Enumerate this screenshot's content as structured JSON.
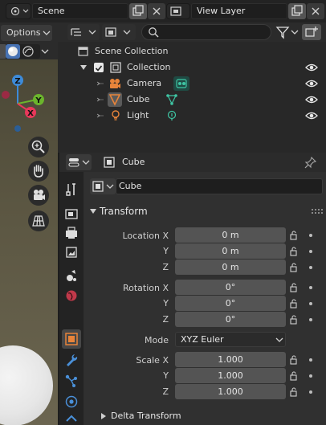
{
  "topbar": {
    "scene_label": "Scene",
    "view_layer_label": "View Layer"
  },
  "viewport": {
    "options_label": "Options",
    "gizmo": {
      "x_label": "X",
      "y_label": "Y",
      "z_label": "Z"
    }
  },
  "outliner": {
    "search_placeholder": "",
    "items": [
      {
        "label": "Scene Collection"
      },
      {
        "label": "Collection"
      },
      {
        "label": "Camera"
      },
      {
        "label": "Cube"
      },
      {
        "label": "Light"
      }
    ]
  },
  "properties": {
    "context_label": "Cube",
    "object_name": "Cube",
    "transform_title": "Transform",
    "location": {
      "label": "Location X",
      "x": "0 m",
      "y": "0 m",
      "z": "0 m"
    },
    "rotation": {
      "label": "Rotation X",
      "x": "0°",
      "y": "0°",
      "z": "0°"
    },
    "mode": {
      "label": "Mode",
      "value": "XYZ Euler"
    },
    "scale": {
      "label": "Scale X",
      "x": "1.000",
      "y": "1.000",
      "z": "1.000"
    },
    "axis_y": "Y",
    "axis_z": "Z",
    "delta_title": "Delta Transform"
  },
  "colors": {
    "x_axis": "#e8385a",
    "y_axis": "#6bb52c",
    "z_axis": "#3d8bd9",
    "active_orange": "#e8843a",
    "teal": "#3fc6a4"
  }
}
